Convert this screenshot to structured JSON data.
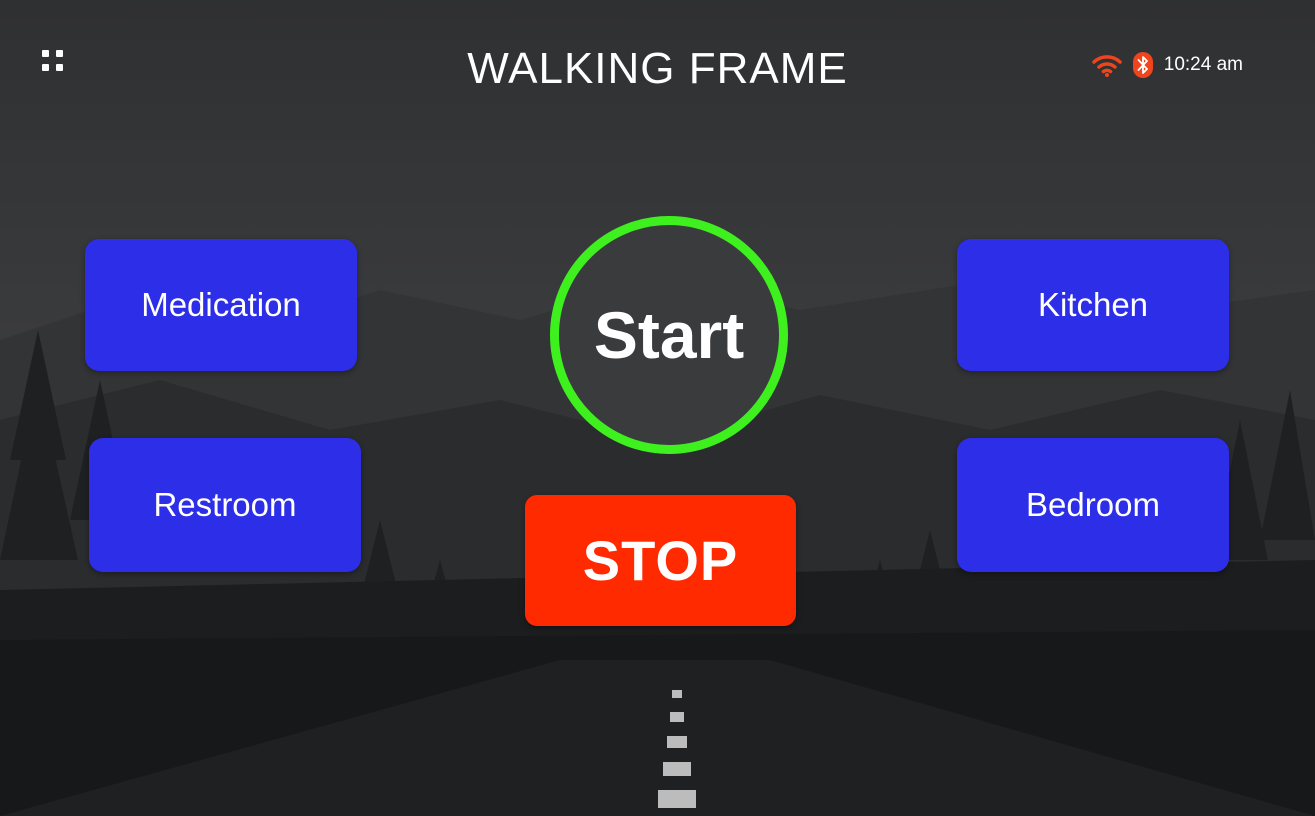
{
  "header": {
    "title": "WALKING FRAME",
    "menu_icon": "grid-menu-icon"
  },
  "status_bar": {
    "wifi_icon": "wifi-icon",
    "bluetooth_icon": "bluetooth-icon",
    "time": "10:24 am",
    "icon_color": "#f0451c"
  },
  "controls": {
    "start_label": "Start",
    "stop_label": "STOP",
    "start_ring_color": "#3ef01e",
    "stop_color": "#ff2a00"
  },
  "destinations": {
    "medication": "Medication",
    "restroom": "Restroom",
    "kitchen": "Kitchen",
    "bedroom": "Bedroom",
    "button_color": "#2c2ee8"
  }
}
